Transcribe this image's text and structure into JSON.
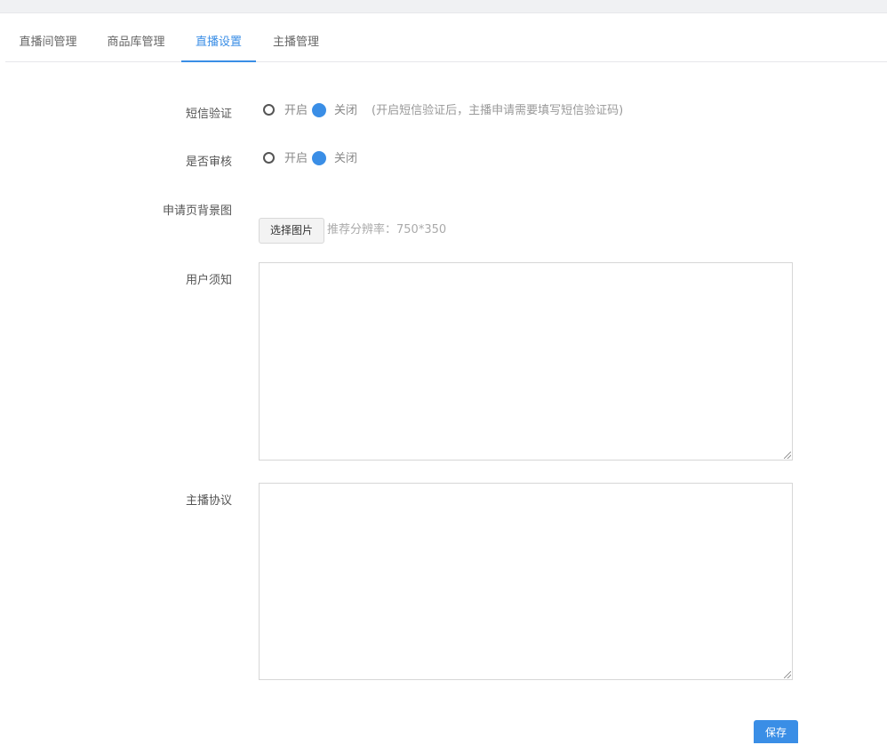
{
  "tabs": [
    {
      "label": "直播间管理",
      "active": false
    },
    {
      "label": "商品库管理",
      "active": false
    },
    {
      "label": "直播设置",
      "active": true
    },
    {
      "label": "主播管理",
      "active": false
    }
  ],
  "form": {
    "sms": {
      "label": "短信验证",
      "options": [
        "开启",
        "关闭"
      ],
      "selected": "关闭",
      "hint": "(开启短信验证后，主播申请需要填写短信验证码)"
    },
    "review": {
      "label": "是否审核",
      "options": [
        "开启",
        "关闭"
      ],
      "selected": "关闭"
    },
    "bg_image": {
      "label": "申请页背景图",
      "button": "选择图片",
      "hint": "推荐分辨率：750*350"
    },
    "user_notice": {
      "label": "用户须知",
      "value": ""
    },
    "anchor_agreement": {
      "label": "主播协议",
      "value": ""
    },
    "save_label": "保存"
  },
  "colors": {
    "accent": "#3a8ee6"
  }
}
